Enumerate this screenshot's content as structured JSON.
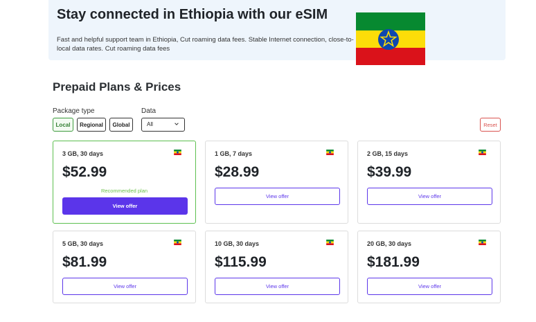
{
  "hero": {
    "title": "Stay connected in Ethiopia with our eSIM",
    "description": "Fast and helpful support team in Ethiopia, Cut roaming data fees. Stable Internet connection, close-to-local data rates. Cut roaming data fees"
  },
  "section_title": "Prepaid Plans & Prices",
  "filters": {
    "package_type_label": "Package type",
    "package_types": [
      "Local",
      "Regional",
      "Global"
    ],
    "data_label": "Data",
    "data_selected": "All",
    "reset_label": "Reset"
  },
  "plans": [
    {
      "subtitle": "3 GB, 30 days",
      "price": "$52.99",
      "badge": "Recommended plan",
      "button": "View offer"
    },
    {
      "subtitle": "1 GB, 7 days",
      "price": "$28.99",
      "button": "View offer"
    },
    {
      "subtitle": "2 GB, 15 days",
      "price": "$39.99",
      "button": "View offer"
    },
    {
      "subtitle": "5 GB, 30 days",
      "price": "$81.99",
      "button": "View offer"
    },
    {
      "subtitle": "10 GB, 30 days",
      "price": "$115.99",
      "button": "View offer"
    },
    {
      "subtitle": "20 GB, 30 days",
      "price": "$181.99",
      "button": "View offer"
    }
  ],
  "colors": {
    "accent": "#5b35ea",
    "active_chip": "#3c9a3c",
    "recommended": "#6cc04a",
    "reset": "#d9534f",
    "flag_green": "#078930",
    "flag_yellow": "#fcdd09",
    "flag_red": "#da121a",
    "flag_emblem": "#0f47af"
  },
  "icons": {
    "flag": "ethiopia-flag-icon",
    "dropdown": "chevron-down-icon"
  }
}
